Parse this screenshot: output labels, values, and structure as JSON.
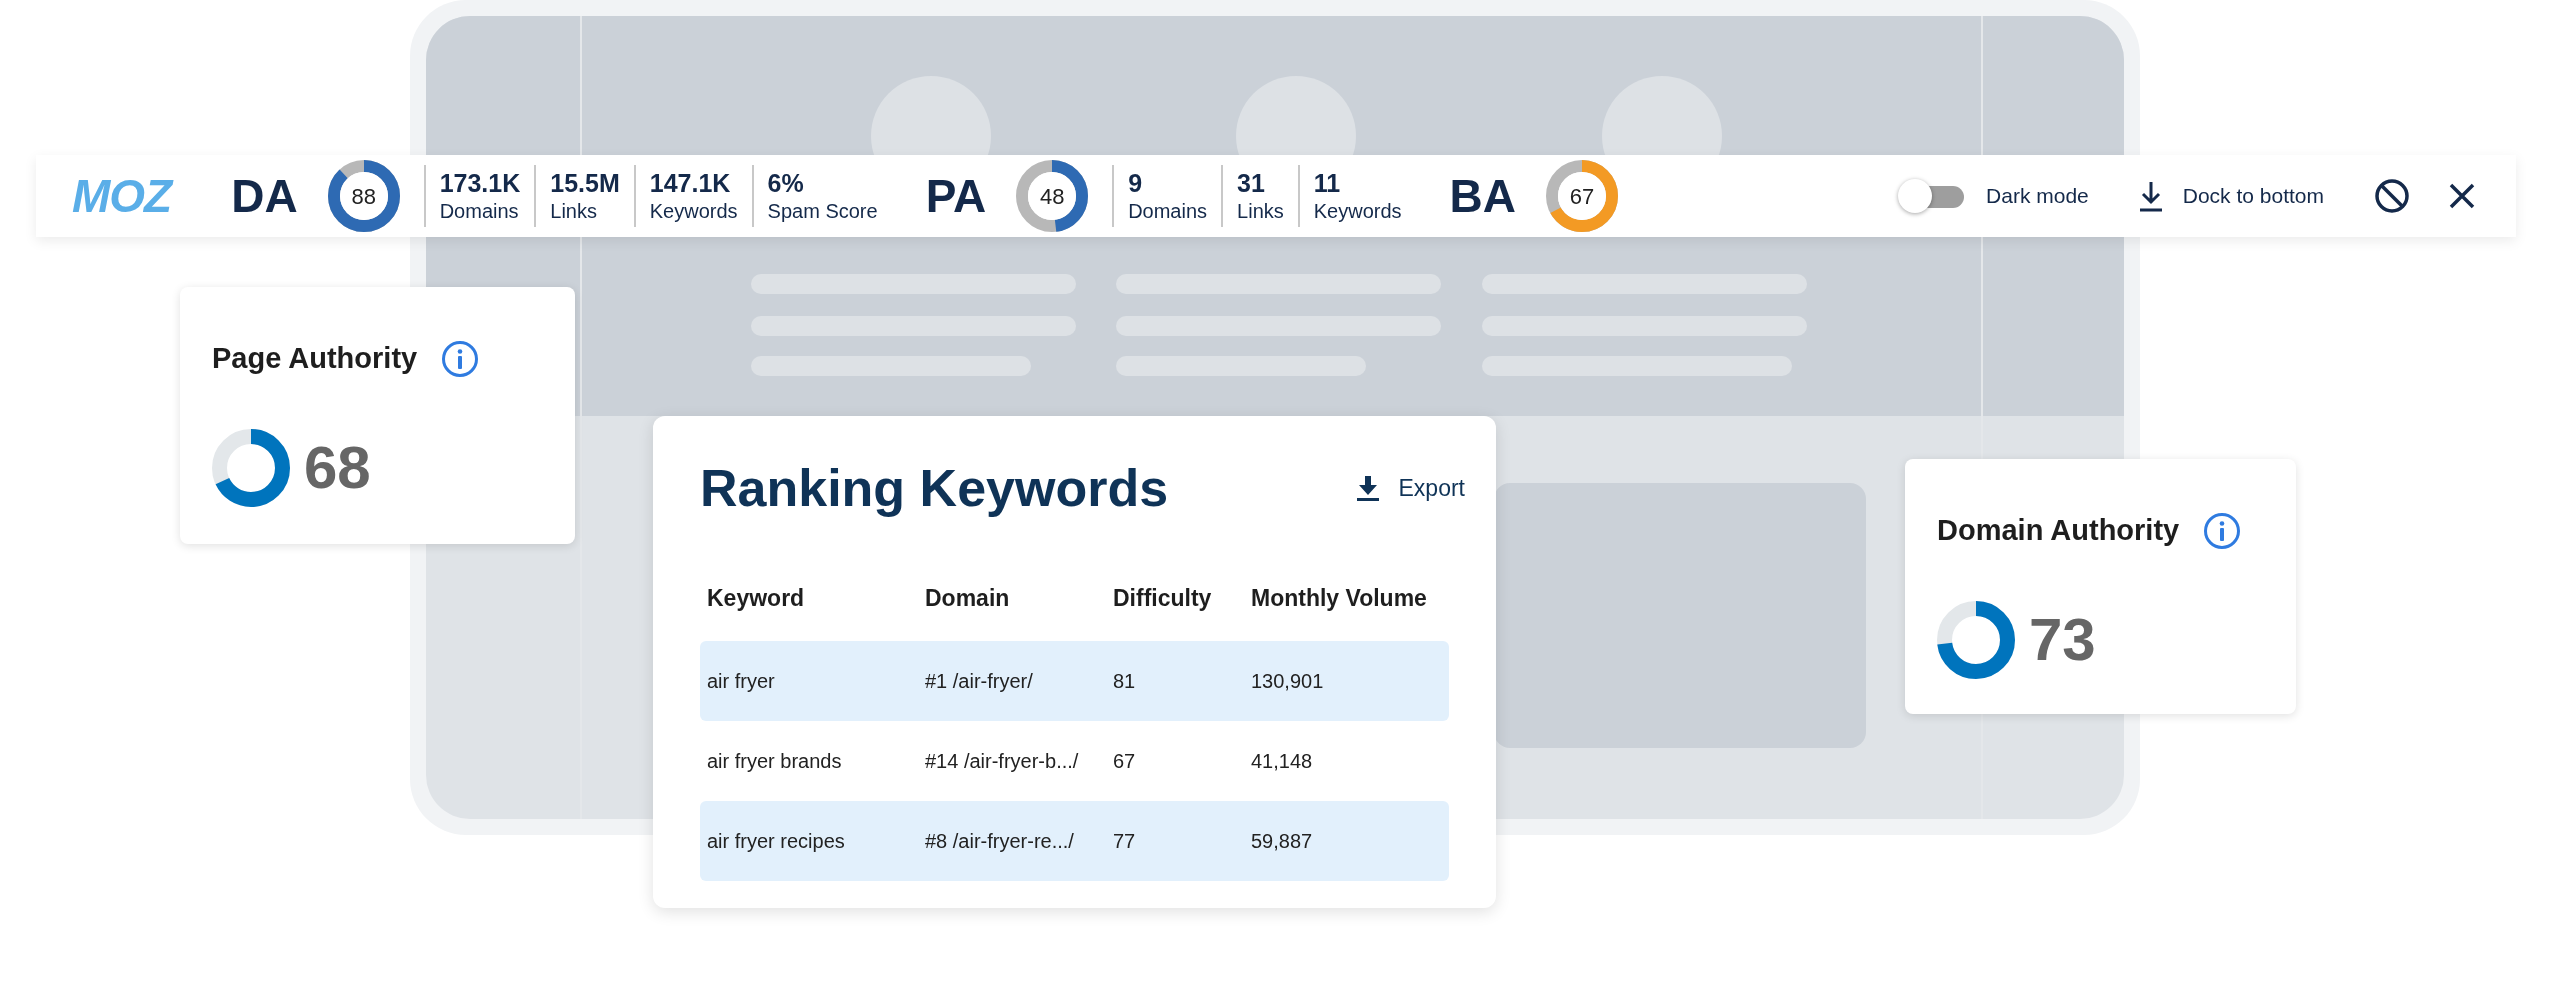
{
  "toolbar": {
    "logo": "MOZ",
    "groups": [
      {
        "score": {
          "label": "DA",
          "value": "88",
          "level": 0.88,
          "color": "#2e6ab3"
        },
        "stats": [
          {
            "value": "173.1K",
            "label": "Domains"
          },
          {
            "value": "15.5M",
            "label": "Links"
          },
          {
            "value": "147.1K",
            "label": "Keywords"
          },
          {
            "value": "6%",
            "label": "Spam Score"
          }
        ]
      },
      {
        "score": {
          "label": "PA",
          "value": "48",
          "level": 0.48,
          "color": "#2e6ab3"
        },
        "stats": [
          {
            "value": "9",
            "label": "Domains"
          },
          {
            "value": "31",
            "label": "Links"
          },
          {
            "value": "11",
            "label": "Keywords"
          }
        ]
      },
      {
        "score": {
          "label": "BA",
          "value": "67",
          "level": 0.67,
          "color": "#f39a24"
        }
      }
    ],
    "dark_mode": {
      "label": "Dark mode",
      "on": false
    },
    "dock": {
      "label": "Dock to bottom"
    }
  },
  "page_authority": {
    "title": "Page Authority",
    "value": "68",
    "level": 0.68
  },
  "ranking_keywords": {
    "title": "Ranking Keywords",
    "export": "Export",
    "columns": [
      "Keyword",
      "Domain",
      "Difficulty",
      "Monthly Volume"
    ],
    "rows": [
      [
        "air fryer",
        "#1 /air-fryer/",
        "81",
        "130,901"
      ],
      [
        "air fryer brands",
        "#14 /air-fryer-b.../",
        "67",
        "41,148"
      ],
      [
        "air fryer recipes",
        "#8 /air-fryer-re.../",
        "77",
        "59,887"
      ]
    ]
  },
  "domain_authority": {
    "title": "Domain Authority",
    "value": "73",
    "level": 0.73
  }
}
